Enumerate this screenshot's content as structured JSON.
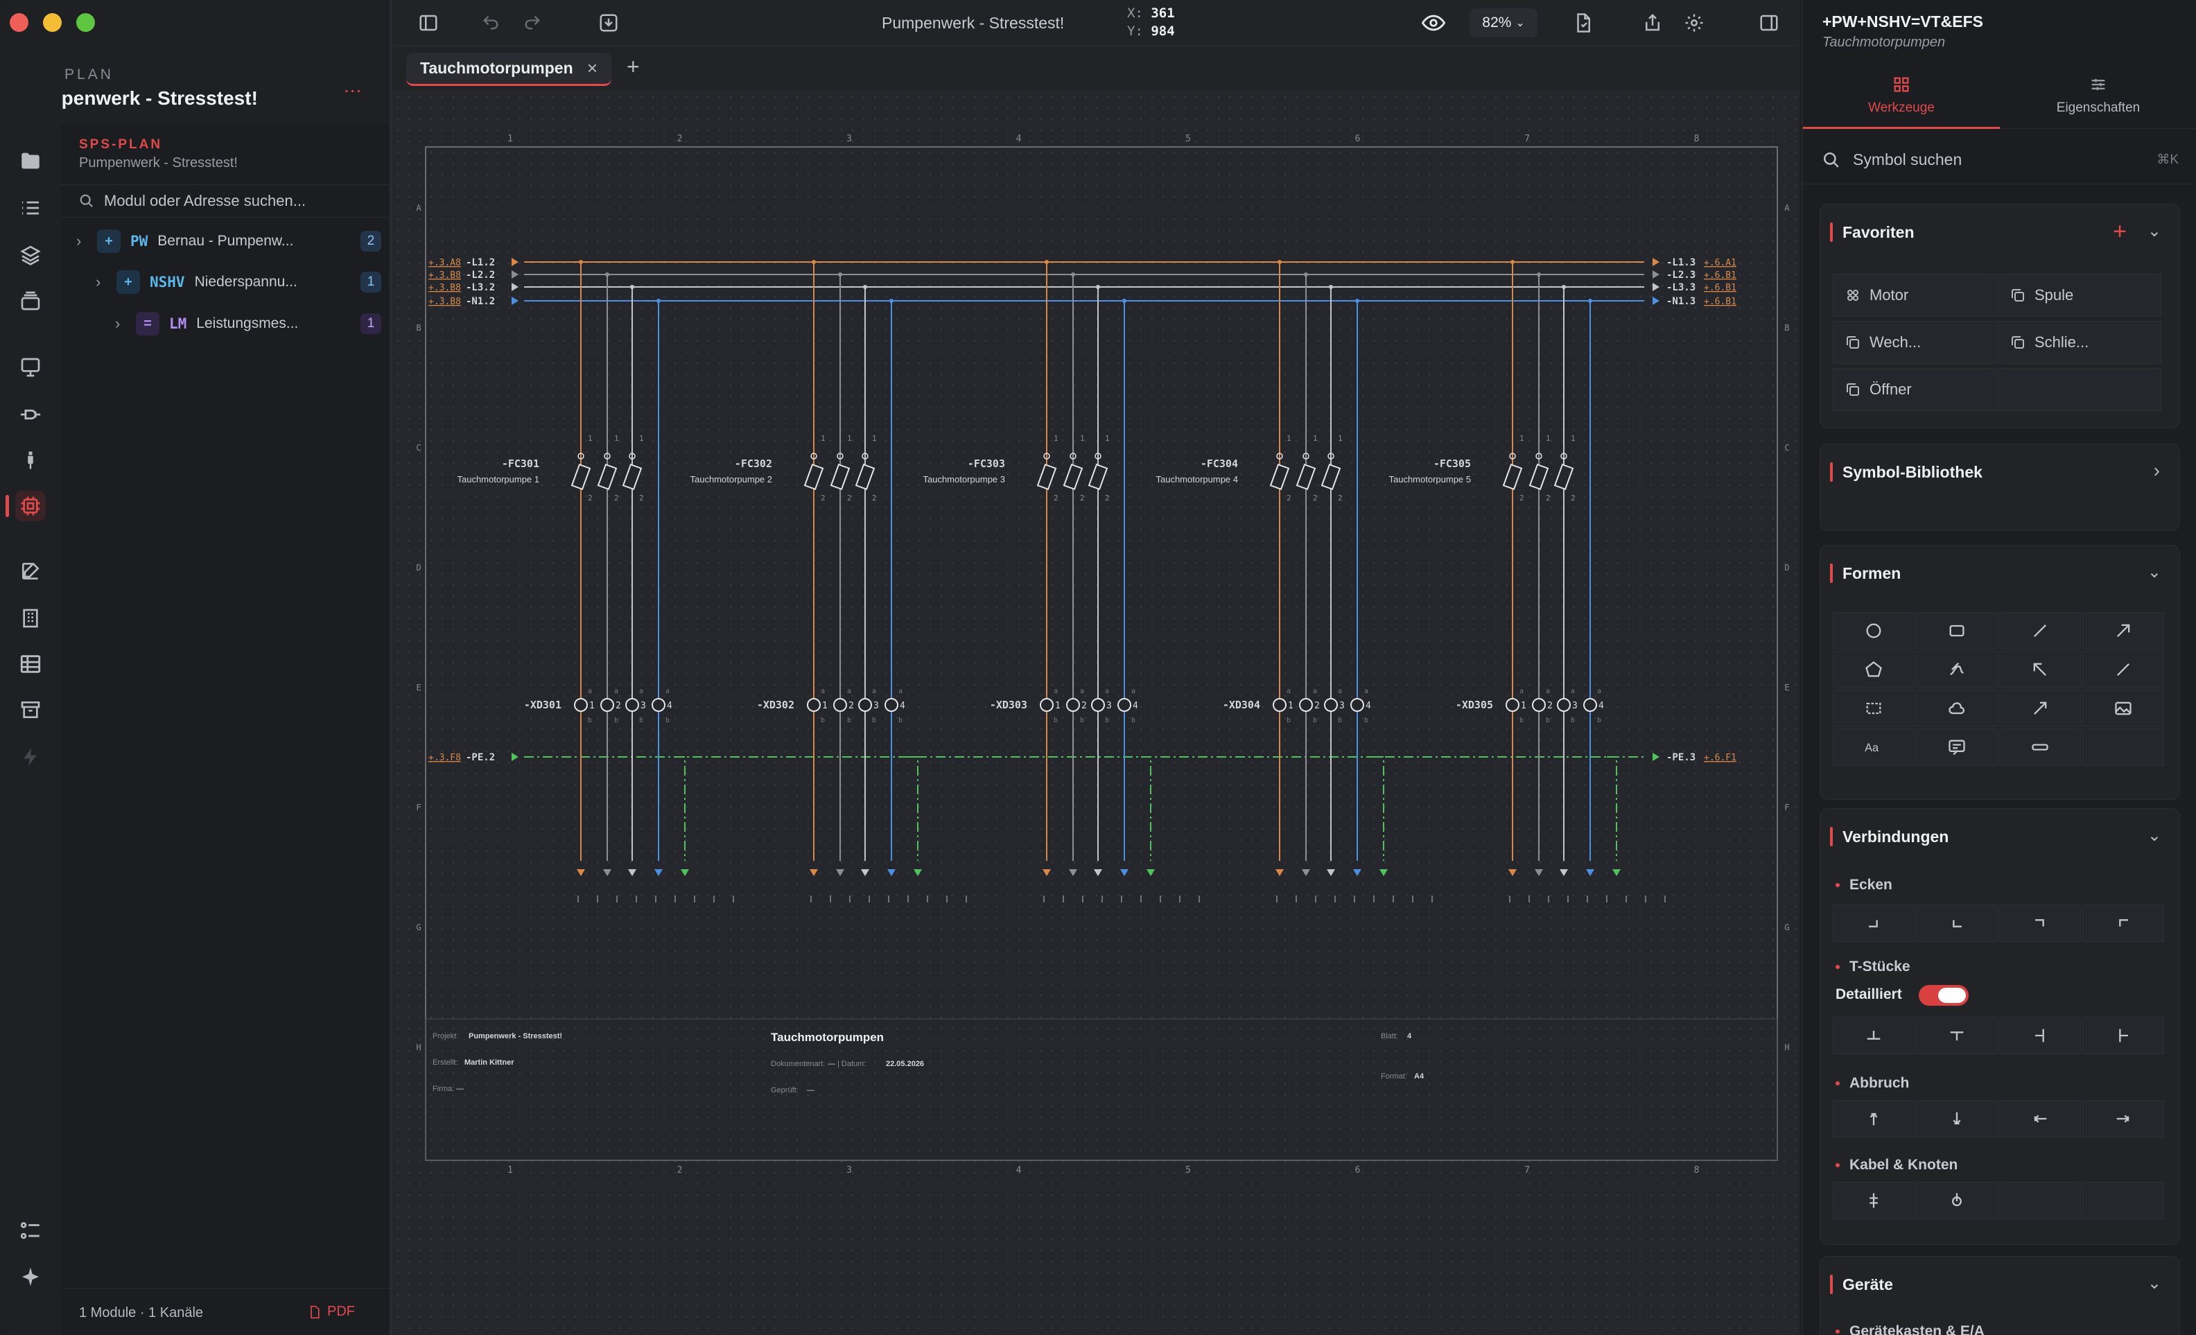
{
  "window": {
    "title": "Pumpenwerk - Stresstest!"
  },
  "project": {
    "kicker": "SPS-PLAN",
    "name": "Pumpenwerk - Stresstest!",
    "more": "..."
  },
  "sidebar": {
    "kicker": "SPS-PLAN",
    "subtitle": "Pumpenwerk - Stresstest!",
    "search_placeholder": "Modul oder Adresse suchen...",
    "tree": [
      {
        "prefix": "+",
        "code": "PW",
        "label": "Bernau - Pumpenw...",
        "count": "2",
        "color": "#5bb6ea"
      },
      {
        "prefix": "+",
        "code": "NSHV",
        "label": "Niederspannu...",
        "count": "1",
        "color": "#5bb6ea"
      },
      {
        "prefix": "=",
        "code": "LM",
        "label": "Leistungsmes...",
        "count": "1",
        "color": "#b38cf0"
      }
    ],
    "footer": {
      "status": "1 Module · 1 Kanäle",
      "pdf": "PDF"
    }
  },
  "toolbar": {
    "title": "Pumpenwerk - Stresstest!",
    "coord_x_label": "X:",
    "coord_x": "361",
    "coord_y_label": "Y:",
    "coord_y": "984",
    "zoom": "82%"
  },
  "tabs": [
    {
      "label": "Tauchmotorpumpen",
      "close": "×"
    }
  ],
  "tab_add": "+",
  "rpanel": {
    "path": "+PW+NSHV=VT&EFS",
    "sub": "Tauchmotorpumpen",
    "tab_tools": "Werkzeuge",
    "tab_props": "Eigenschaften",
    "search_placeholder": "Symbol suchen",
    "search_shortcut": "⌘K",
    "favorites_title": "Favoriten",
    "favorites": [
      "Motor",
      "Spule",
      "Wech...",
      "Schlie...",
      "Öffner"
    ],
    "library_title": "Symbol-Bibliothek",
    "shapes_title": "Formen",
    "connections_title": "Verbindungen",
    "corners": "Ecken",
    "tees": "T-Stücke",
    "detailed": "Detailliert",
    "breaks": "Abbruch",
    "cables": "Kabel & Knoten",
    "devices_title": "Geräte",
    "devices_sub": "Gerätekasten & E/A"
  },
  "sheet": {
    "col_numbers": [
      "1",
      "2",
      "3",
      "4",
      "5",
      "6",
      "7",
      "8"
    ],
    "row_letters": [
      "A",
      "B",
      "C",
      "D",
      "E",
      "F",
      "G",
      "H"
    ],
    "bus_left": [
      {
        "ref": "+.3.A8",
        "name": "-L1.2",
        "color": "#d8894a"
      },
      {
        "ref": "+.3.B8",
        "name": "-L2.2",
        "color": "#9a9ca3"
      },
      {
        "ref": "+.3.B8",
        "name": "-L3.2",
        "color": "#c9cbd0"
      },
      {
        "ref": "+.3.B8",
        "name": "-N1.2",
        "color": "#4d8fe0"
      }
    ],
    "bus_right": [
      {
        "name": "-L1.3",
        "ref": "+.6.A1"
      },
      {
        "name": "-L2.3",
        "ref": "+.6.B1"
      },
      {
        "name": "-L3.3",
        "ref": "+.6.B1"
      },
      {
        "name": "-N1.3",
        "ref": "+.6.B1"
      }
    ],
    "pe_left": {
      "ref": "+.3.F8",
      "name": "-PE.2"
    },
    "pe_right": {
      "name": "-PE.3",
      "ref": "+.6.F1"
    },
    "breakers": [
      {
        "id": "-FC301",
        "desc": "Tauchmotorpumpe 1"
      },
      {
        "id": "-FC302",
        "desc": "Tauchmotorpumpe 2"
      },
      {
        "id": "-FC303",
        "desc": "Tauchmotorpumpe 3"
      },
      {
        "id": "-FC304",
        "desc": "Tauchmotorpumpe 4"
      },
      {
        "id": "-FC305",
        "desc": "Tauchmotorpumpe 5"
      }
    ],
    "terminals": [
      "-XD301",
      "-XD302",
      "-XD303",
      "-XD304",
      "-XD305"
    ],
    "titleblock": {
      "project_label": "Projekt:",
      "project": "Pumpenwerk - Stresstest!",
      "created_label": "Erstellt:",
      "created": "Martin Kittner",
      "company_label": "Firma:",
      "company": "—",
      "title": "Tauchmotorpumpen",
      "doctype_label": "Dokumentenart:",
      "doctype": "—",
      "date_label": "| Datum:",
      "date": "22.05.2026",
      "checked_label": "Geprüft:",
      "checked": "—",
      "sheet_label": "Blatt:",
      "sheet": "4",
      "format_label": "Format:",
      "format": "A4"
    }
  }
}
